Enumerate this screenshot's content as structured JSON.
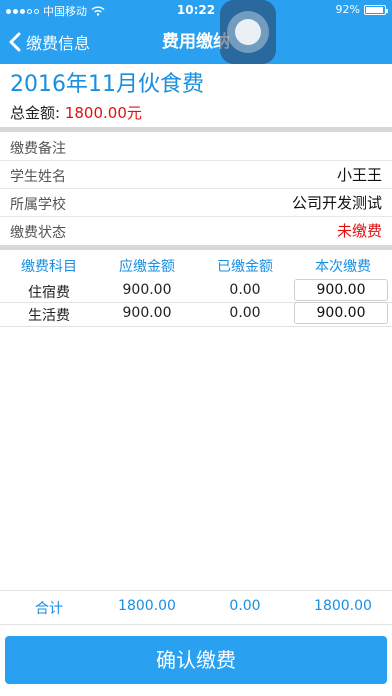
{
  "status_bar": {
    "carrier": "中国移动",
    "time": "10:22",
    "battery": "92%",
    "battery_level": 0.92
  },
  "nav": {
    "back_label": "缴费信息",
    "title": "费用缴纳"
  },
  "fee": {
    "title": "2016年11月伙食费",
    "total_label": "总金额:",
    "total_amount": "1800.00元"
  },
  "info": {
    "note_label": "缴费备注",
    "note_value": "",
    "student_label": "学生姓名",
    "student_value": "小王王",
    "school_label": "所属学校",
    "school_value": "公司开发测试",
    "status_label": "缴费状态",
    "status_value": "未缴费",
    "status_color": "#e01010"
  },
  "table": {
    "headers": [
      "缴费科目",
      "应缴金额",
      "已缴金额",
      "本次缴费"
    ],
    "rows": [
      {
        "item": "住宿费",
        "due": "900.00",
        "paid": "0.00",
        "pay_now": "900.00"
      },
      {
        "item": "生活费",
        "due": "900.00",
        "paid": "0.00",
        "pay_now": "900.00"
      }
    ],
    "footer": {
      "label": "合计",
      "due": "1800.00",
      "paid": "0.00",
      "pay_now": "1800.00"
    }
  },
  "confirm_label": "确认缴费",
  "colors": {
    "accent": "#2aa0f0",
    "header_text": "#1a8fe0",
    "alert": "#e01010"
  }
}
